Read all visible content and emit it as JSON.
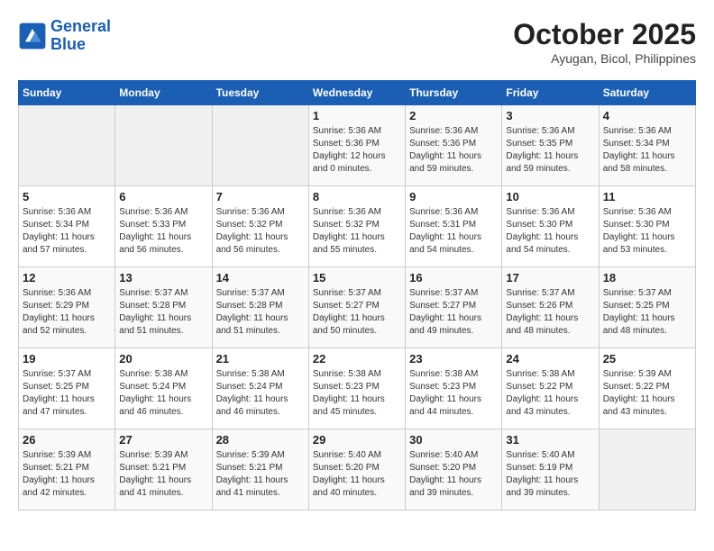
{
  "header": {
    "logo_line1": "General",
    "logo_line2": "Blue",
    "month": "October 2025",
    "location": "Ayugan, Bicol, Philippines"
  },
  "days_of_week": [
    "Sunday",
    "Monday",
    "Tuesday",
    "Wednesday",
    "Thursday",
    "Friday",
    "Saturday"
  ],
  "weeks": [
    [
      {
        "day": "",
        "info": ""
      },
      {
        "day": "",
        "info": ""
      },
      {
        "day": "",
        "info": ""
      },
      {
        "day": "1",
        "info": "Sunrise: 5:36 AM\nSunset: 5:36 PM\nDaylight: 12 hours\nand 0 minutes."
      },
      {
        "day": "2",
        "info": "Sunrise: 5:36 AM\nSunset: 5:36 PM\nDaylight: 11 hours\nand 59 minutes."
      },
      {
        "day": "3",
        "info": "Sunrise: 5:36 AM\nSunset: 5:35 PM\nDaylight: 11 hours\nand 59 minutes."
      },
      {
        "day": "4",
        "info": "Sunrise: 5:36 AM\nSunset: 5:34 PM\nDaylight: 11 hours\nand 58 minutes."
      }
    ],
    [
      {
        "day": "5",
        "info": "Sunrise: 5:36 AM\nSunset: 5:34 PM\nDaylight: 11 hours\nand 57 minutes."
      },
      {
        "day": "6",
        "info": "Sunrise: 5:36 AM\nSunset: 5:33 PM\nDaylight: 11 hours\nand 56 minutes."
      },
      {
        "day": "7",
        "info": "Sunrise: 5:36 AM\nSunset: 5:32 PM\nDaylight: 11 hours\nand 56 minutes."
      },
      {
        "day": "8",
        "info": "Sunrise: 5:36 AM\nSunset: 5:32 PM\nDaylight: 11 hours\nand 55 minutes."
      },
      {
        "day": "9",
        "info": "Sunrise: 5:36 AM\nSunset: 5:31 PM\nDaylight: 11 hours\nand 54 minutes."
      },
      {
        "day": "10",
        "info": "Sunrise: 5:36 AM\nSunset: 5:30 PM\nDaylight: 11 hours\nand 54 minutes."
      },
      {
        "day": "11",
        "info": "Sunrise: 5:36 AM\nSunset: 5:30 PM\nDaylight: 11 hours\nand 53 minutes."
      }
    ],
    [
      {
        "day": "12",
        "info": "Sunrise: 5:36 AM\nSunset: 5:29 PM\nDaylight: 11 hours\nand 52 minutes."
      },
      {
        "day": "13",
        "info": "Sunrise: 5:37 AM\nSunset: 5:28 PM\nDaylight: 11 hours\nand 51 minutes."
      },
      {
        "day": "14",
        "info": "Sunrise: 5:37 AM\nSunset: 5:28 PM\nDaylight: 11 hours\nand 51 minutes."
      },
      {
        "day": "15",
        "info": "Sunrise: 5:37 AM\nSunset: 5:27 PM\nDaylight: 11 hours\nand 50 minutes."
      },
      {
        "day": "16",
        "info": "Sunrise: 5:37 AM\nSunset: 5:27 PM\nDaylight: 11 hours\nand 49 minutes."
      },
      {
        "day": "17",
        "info": "Sunrise: 5:37 AM\nSunset: 5:26 PM\nDaylight: 11 hours\nand 48 minutes."
      },
      {
        "day": "18",
        "info": "Sunrise: 5:37 AM\nSunset: 5:25 PM\nDaylight: 11 hours\nand 48 minutes."
      }
    ],
    [
      {
        "day": "19",
        "info": "Sunrise: 5:37 AM\nSunset: 5:25 PM\nDaylight: 11 hours\nand 47 minutes."
      },
      {
        "day": "20",
        "info": "Sunrise: 5:38 AM\nSunset: 5:24 PM\nDaylight: 11 hours\nand 46 minutes."
      },
      {
        "day": "21",
        "info": "Sunrise: 5:38 AM\nSunset: 5:24 PM\nDaylight: 11 hours\nand 46 minutes."
      },
      {
        "day": "22",
        "info": "Sunrise: 5:38 AM\nSunset: 5:23 PM\nDaylight: 11 hours\nand 45 minutes."
      },
      {
        "day": "23",
        "info": "Sunrise: 5:38 AM\nSunset: 5:23 PM\nDaylight: 11 hours\nand 44 minutes."
      },
      {
        "day": "24",
        "info": "Sunrise: 5:38 AM\nSunset: 5:22 PM\nDaylight: 11 hours\nand 43 minutes."
      },
      {
        "day": "25",
        "info": "Sunrise: 5:39 AM\nSunset: 5:22 PM\nDaylight: 11 hours\nand 43 minutes."
      }
    ],
    [
      {
        "day": "26",
        "info": "Sunrise: 5:39 AM\nSunset: 5:21 PM\nDaylight: 11 hours\nand 42 minutes."
      },
      {
        "day": "27",
        "info": "Sunrise: 5:39 AM\nSunset: 5:21 PM\nDaylight: 11 hours\nand 41 minutes."
      },
      {
        "day": "28",
        "info": "Sunrise: 5:39 AM\nSunset: 5:21 PM\nDaylight: 11 hours\nand 41 minutes."
      },
      {
        "day": "29",
        "info": "Sunrise: 5:40 AM\nSunset: 5:20 PM\nDaylight: 11 hours\nand 40 minutes."
      },
      {
        "day": "30",
        "info": "Sunrise: 5:40 AM\nSunset: 5:20 PM\nDaylight: 11 hours\nand 39 minutes."
      },
      {
        "day": "31",
        "info": "Sunrise: 5:40 AM\nSunset: 5:19 PM\nDaylight: 11 hours\nand 39 minutes."
      },
      {
        "day": "",
        "info": ""
      }
    ]
  ]
}
